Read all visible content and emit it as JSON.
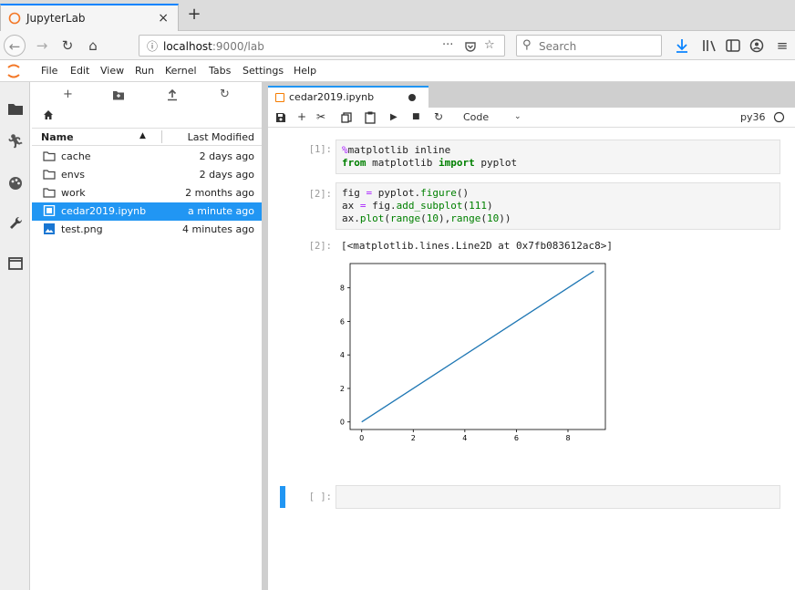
{
  "browser": {
    "tab_title": "JupyterLab",
    "tab_close": "×",
    "new_tab": "+",
    "url_host": "localhost",
    "url_rest": ":9000/lab",
    "url_more": "···",
    "search_placeholder": "Search"
  },
  "menu": [
    "File",
    "Edit",
    "View",
    "Run",
    "Kernel",
    "Tabs",
    "Settings",
    "Help"
  ],
  "filebrowser": {
    "header_name": "Name",
    "header_modified": "Last Modified",
    "files": [
      {
        "name": "cache",
        "modified": "2 days ago",
        "type": "folder"
      },
      {
        "name": "envs",
        "modified": "2 days ago",
        "type": "folder"
      },
      {
        "name": "work",
        "modified": "2 months ago",
        "type": "folder"
      },
      {
        "name": "cedar2019.ipynb",
        "modified": "a minute ago",
        "type": "notebook",
        "selected": true
      },
      {
        "name": "test.png",
        "modified": "4 minutes ago",
        "type": "image"
      }
    ]
  },
  "notebook": {
    "tab_title": "cedar2019.ipynb",
    "cell_type": "Code",
    "kernel": "py36",
    "cells": [
      {
        "prompt": "[1]:"
      },
      {
        "prompt": "[2]:"
      },
      {
        "prompt": "[ ]:"
      }
    ],
    "output_prompt": "[2]:",
    "output_text": "[<matplotlib.lines.Line2D at 0x7fb083612ac8>]"
  },
  "chart_data": {
    "type": "line",
    "x": [
      0,
      1,
      2,
      3,
      4,
      5,
      6,
      7,
      8,
      9
    ],
    "series": [
      {
        "values": [
          0,
          1,
          2,
          3,
          4,
          5,
          6,
          7,
          8,
          9
        ],
        "color": "#1f77b4"
      }
    ],
    "xticks": [
      "0",
      "2",
      "4",
      "6",
      "8"
    ],
    "yticks": [
      "0",
      "2",
      "4",
      "6",
      "8"
    ],
    "xlim": [
      -0.45,
      9.45
    ],
    "ylim": [
      -0.45,
      9.45
    ],
    "title": "",
    "xlabel": "",
    "ylabel": ""
  },
  "colors": {
    "accent": "#2196f3",
    "selection": "#2196f3",
    "line": "#1f77b4"
  }
}
